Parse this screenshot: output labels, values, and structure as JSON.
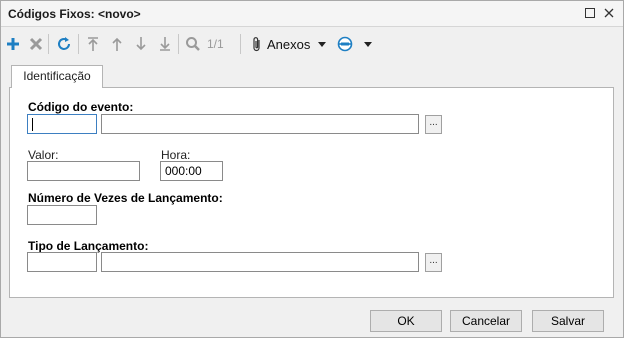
{
  "window": {
    "title": "Códigos Fixos: <novo>",
    "controls": {
      "maximize": "☐",
      "close": "✕"
    }
  },
  "toolbar": {
    "icons": [
      "add-icon",
      "delete-icon",
      "refresh-icon",
      "first-record-icon",
      "previous-record-icon",
      "next-record-icon",
      "last-record-icon",
      "search-icon",
      "paperclip-icon",
      "globe-icon"
    ],
    "pager": "1/1",
    "anexos_label": "Anexos"
  },
  "tabs": [
    {
      "label": "Identificação",
      "active": true
    }
  ],
  "form": {
    "codigo_evento_label": "Código do evento:",
    "codigo_evento_value": "",
    "codigo_evento_desc": "",
    "valor_label": "Valor:",
    "valor_value": "",
    "hora_label": "Hora:",
    "hora_value": "000:00",
    "num_vezes_label": "Número de Vezes de Lançamento:",
    "num_vezes_value": "",
    "tipo_lancamento_label": "Tipo de Lançamento:",
    "tipo_lancamento_value": "",
    "tipo_lancamento_desc": "",
    "lookup_label": "..."
  },
  "buttons": {
    "ok": "OK",
    "cancel": "Cancelar",
    "save": "Salvar"
  },
  "colors": {
    "accent_blue": "#1e7fc3",
    "focus_border": "#3d7fc1",
    "disabled_gray": "#9a9a9a"
  }
}
